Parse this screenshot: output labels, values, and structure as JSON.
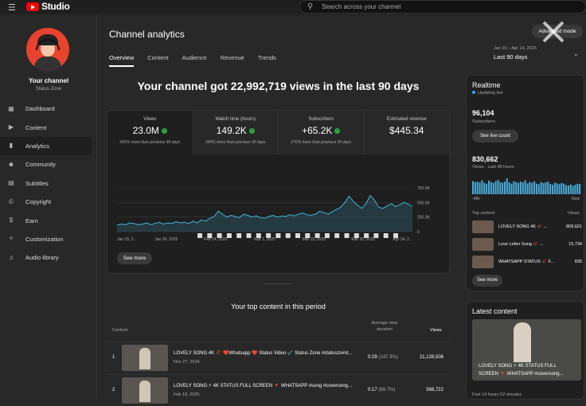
{
  "topbar": {
    "app": "Studio",
    "search_placeholder": "Search across your channel"
  },
  "sidebar": {
    "channel_name": "Your channel",
    "channel_sub": "Status Zone",
    "items": [
      {
        "label": "Dashboard",
        "icon": "dashboard-icon"
      },
      {
        "label": "Content",
        "icon": "content-icon"
      },
      {
        "label": "Analytics",
        "icon": "analytics-icon"
      },
      {
        "label": "Community",
        "icon": "community-icon"
      },
      {
        "label": "Subtitles",
        "icon": "subtitles-icon"
      },
      {
        "label": "Copyright",
        "icon": "copyright-icon"
      },
      {
        "label": "Earn",
        "icon": "earn-icon"
      },
      {
        "label": "Customization",
        "icon": "customization-icon"
      },
      {
        "label": "Audio library",
        "icon": "audio-library-icon"
      }
    ]
  },
  "main": {
    "title": "Channel analytics",
    "advanced": "Advanced mode",
    "tabs": [
      "Overview",
      "Content",
      "Audience",
      "Revenue",
      "Trends"
    ],
    "date_range": "Jan 15 – Apr 14, 2025",
    "date_label": "Last 90 days",
    "headline": "Your channel got 22,992,719 views in the last 90 days",
    "metrics": [
      {
        "label": "Views",
        "value": "23.0M",
        "compare": "341% more than previous 90 days"
      },
      {
        "label": "Watch time (hours)",
        "value": "149.2K",
        "compare": "345% more than previous 90 days"
      },
      {
        "label": "Subscribers",
        "value": "+65.2K",
        "compare": "276% more than previous 90 days"
      },
      {
        "label": "Estimated revenue",
        "value": "$445.34",
        "compare": ""
      }
    ],
    "see_more": "See more",
    "top_content_title": "Your top content in this period",
    "table_headers": {
      "content": "Content",
      "avg": "Average view duration",
      "views": "Views"
    },
    "rows": [
      {
        "num": "1",
        "title": "LOVELY SONG 4K 🥀 ❤️Whatsapp ❤️ Status Video ✔️ Status Zone #statuszo#st...",
        "date": "Nov 27, 2024",
        "duration": "0:29",
        "pct": "(147.3%)",
        "views": "21,126,506"
      },
      {
        "num": "2",
        "title": "LOVELY SONG ⚡ 4K STATUS FULL SCREEN 🔻 WHATSAPP #song #coversong...",
        "date": "Feb 18, 2025",
        "duration": "0:17",
        "pct": "(89.7%)",
        "views": "566,722"
      }
    ]
  },
  "chart_data": {
    "type": "area",
    "x_ticks": [
      "Jan 15, 2...",
      "Jan 30, 2025",
      "Feb 14, 2025",
      "Mar 1, 2025",
      "Mar 15, 2025",
      "Mar 30, 2025",
      "Apr 14, 2..."
    ],
    "y_ticks": [
      "750.0K",
      "500.0K",
      "250.0K",
      "0"
    ],
    "ylim": [
      0,
      750000
    ],
    "values": [
      110000,
      130000,
      120000,
      150000,
      140000,
      120000,
      130000,
      150000,
      120000,
      140000,
      160000,
      130000,
      150000,
      140000,
      170000,
      150000,
      160000,
      140000,
      180000,
      150000,
      200000,
      180000,
      230000,
      260000,
      350000,
      300000,
      250000,
      280000,
      260000,
      240000,
      300000,
      280000,
      250000,
      270000,
      240000,
      230000,
      260000,
      280000,
      250000,
      270000,
      260000,
      290000,
      270000,
      300000,
      320000,
      290000,
      280000,
      300000,
      350000,
      330000,
      300000,
      340000,
      380000,
      420000,
      500000,
      610000,
      520000,
      450000,
      400000,
      480000,
      620000,
      540000,
      420000,
      400000,
      440000,
      480000,
      430000,
      460000,
      500000,
      470000,
      430000
    ],
    "line_color": "#41b4d9"
  },
  "realtime": {
    "title": "Realtime",
    "status": "Updating live",
    "subs": "96,104",
    "subs_label": "Subscribers",
    "live_count": "See live count",
    "views": "830,662",
    "views_label": "Views · Last 48 hours",
    "ax_left": "-48h",
    "ax_right": "Now",
    "top_label": "Top content",
    "views_col": "Views",
    "bars": [
      0.75,
      0.7,
      0.72,
      0.68,
      0.8,
      0.66,
      0.6,
      0.78,
      0.7,
      0.65,
      0.74,
      0.82,
      0.7,
      0.66,
      0.72,
      0.9,
      0.68,
      0.6,
      0.74,
      0.7,
      0.65,
      0.72,
      0.68,
      0.8,
      0.62,
      0.7,
      0.66,
      0.74,
      0.6,
      0.58,
      0.7,
      0.64,
      0.68,
      0.72,
      0.6,
      0.55,
      0.66,
      0.62,
      0.58,
      0.64,
      0.6,
      0.52,
      0.5,
      0.56,
      0.48,
      0.54,
      0.6,
      0.58
    ],
    "top": [
      {
        "title": "LOVELY SONG 4K 🥀 ...",
        "views": "809,621"
      },
      {
        "title": "Love Letter Song 🥀 ...",
        "views": "15,734"
      },
      {
        "title": "WHATSAPP STATUS 🥀 F...",
        "views": "835"
      }
    ],
    "see_more": "See more"
  },
  "latest": {
    "title": "Latest content",
    "caption1": "LOVELY SONG ⚡ 4K STATUS FULL",
    "caption2": "SCREEN 🔻 WHATSAPP #coversong...",
    "footer": "First 14 hours 52 minutes"
  }
}
